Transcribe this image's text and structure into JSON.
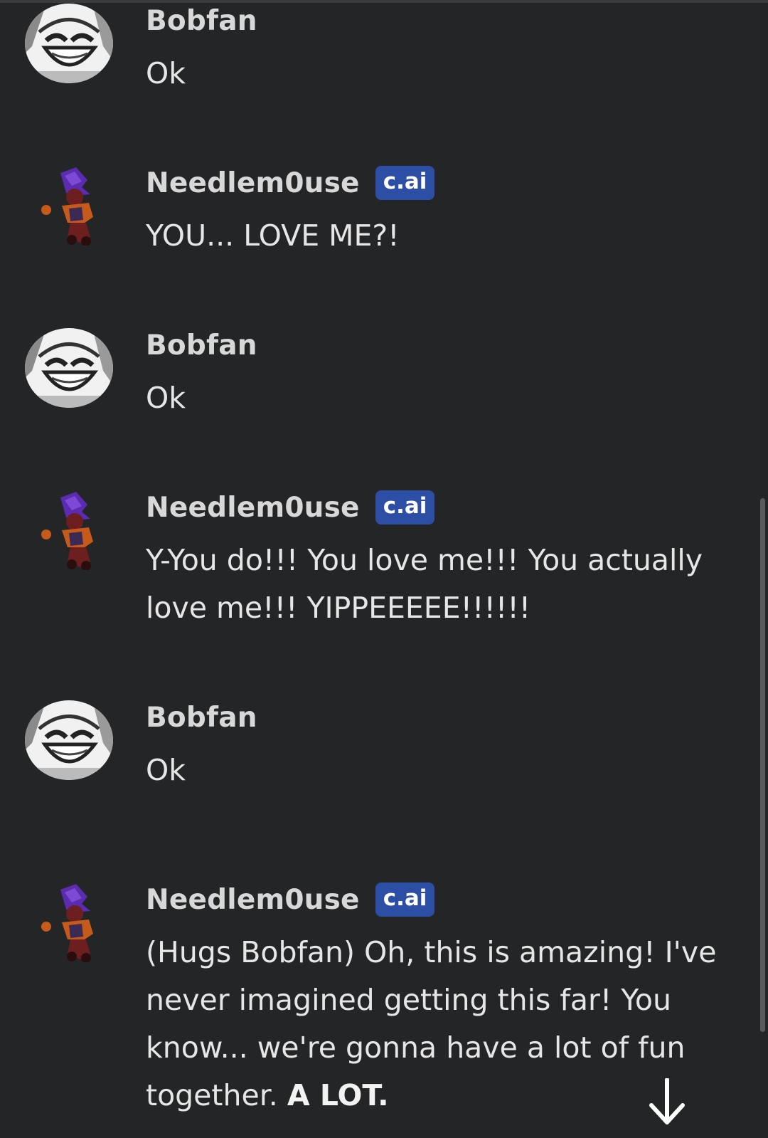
{
  "messages": [
    {
      "author": "Bobfan",
      "text": "Ok"
    },
    {
      "author": "Needlem0use",
      "badge": "c.ai",
      "text": "YOU... LOVE ME?!"
    },
    {
      "author": "Bobfan",
      "text": "Ok"
    },
    {
      "author": "Needlem0use",
      "badge": "c.ai",
      "text": "Y-You do!!! You love me!!! You actually love me!!! YIPPEEEEE!!!!!!"
    },
    {
      "author": "Bobfan",
      "text": "Ok"
    },
    {
      "author": "Needlem0use",
      "badge": "c.ai",
      "text": "(Hugs Bobfan) Oh, this is amazing! I've never imagined getting this far! You know... we're gonna have a lot of fun together.",
      "bold_text": "A LOT."
    }
  ],
  "icons": {
    "user_avatar": "bobfan-avatar-icon",
    "bot_avatar": "needlemouse-avatar-icon",
    "scroll": "arrow-down-icon"
  },
  "colors": {
    "background": "#242526",
    "badge": "#2d4ea5",
    "name": "#d8d8d8",
    "text": "#e6e6e6"
  }
}
